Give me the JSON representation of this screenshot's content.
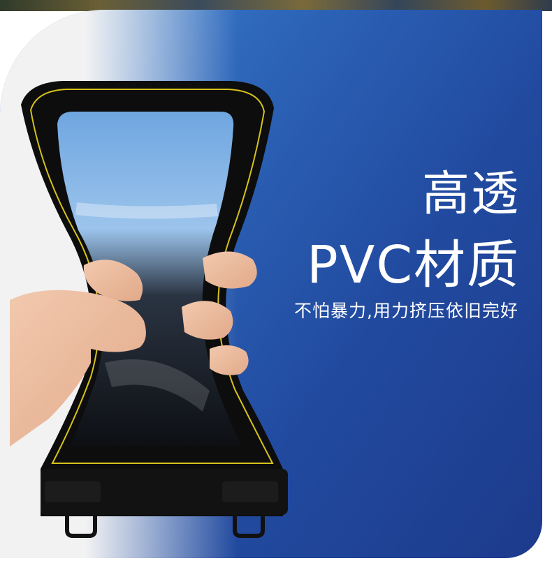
{
  "headline": {
    "line1": "高透",
    "line2": "PVC材质"
  },
  "subline": "不怕暴力,用力挤压依旧完好",
  "colors": {
    "panel_start": "#3f86d2",
    "panel_end": "#1d3a8c",
    "background": "#f2f2f3",
    "text": "#ffffff",
    "pouch": "#0d0d0d",
    "pouch_trim": "#d6c21c"
  },
  "icons": [
    "waterproof-phone-pouch-illustration",
    "hand-illustration"
  ]
}
